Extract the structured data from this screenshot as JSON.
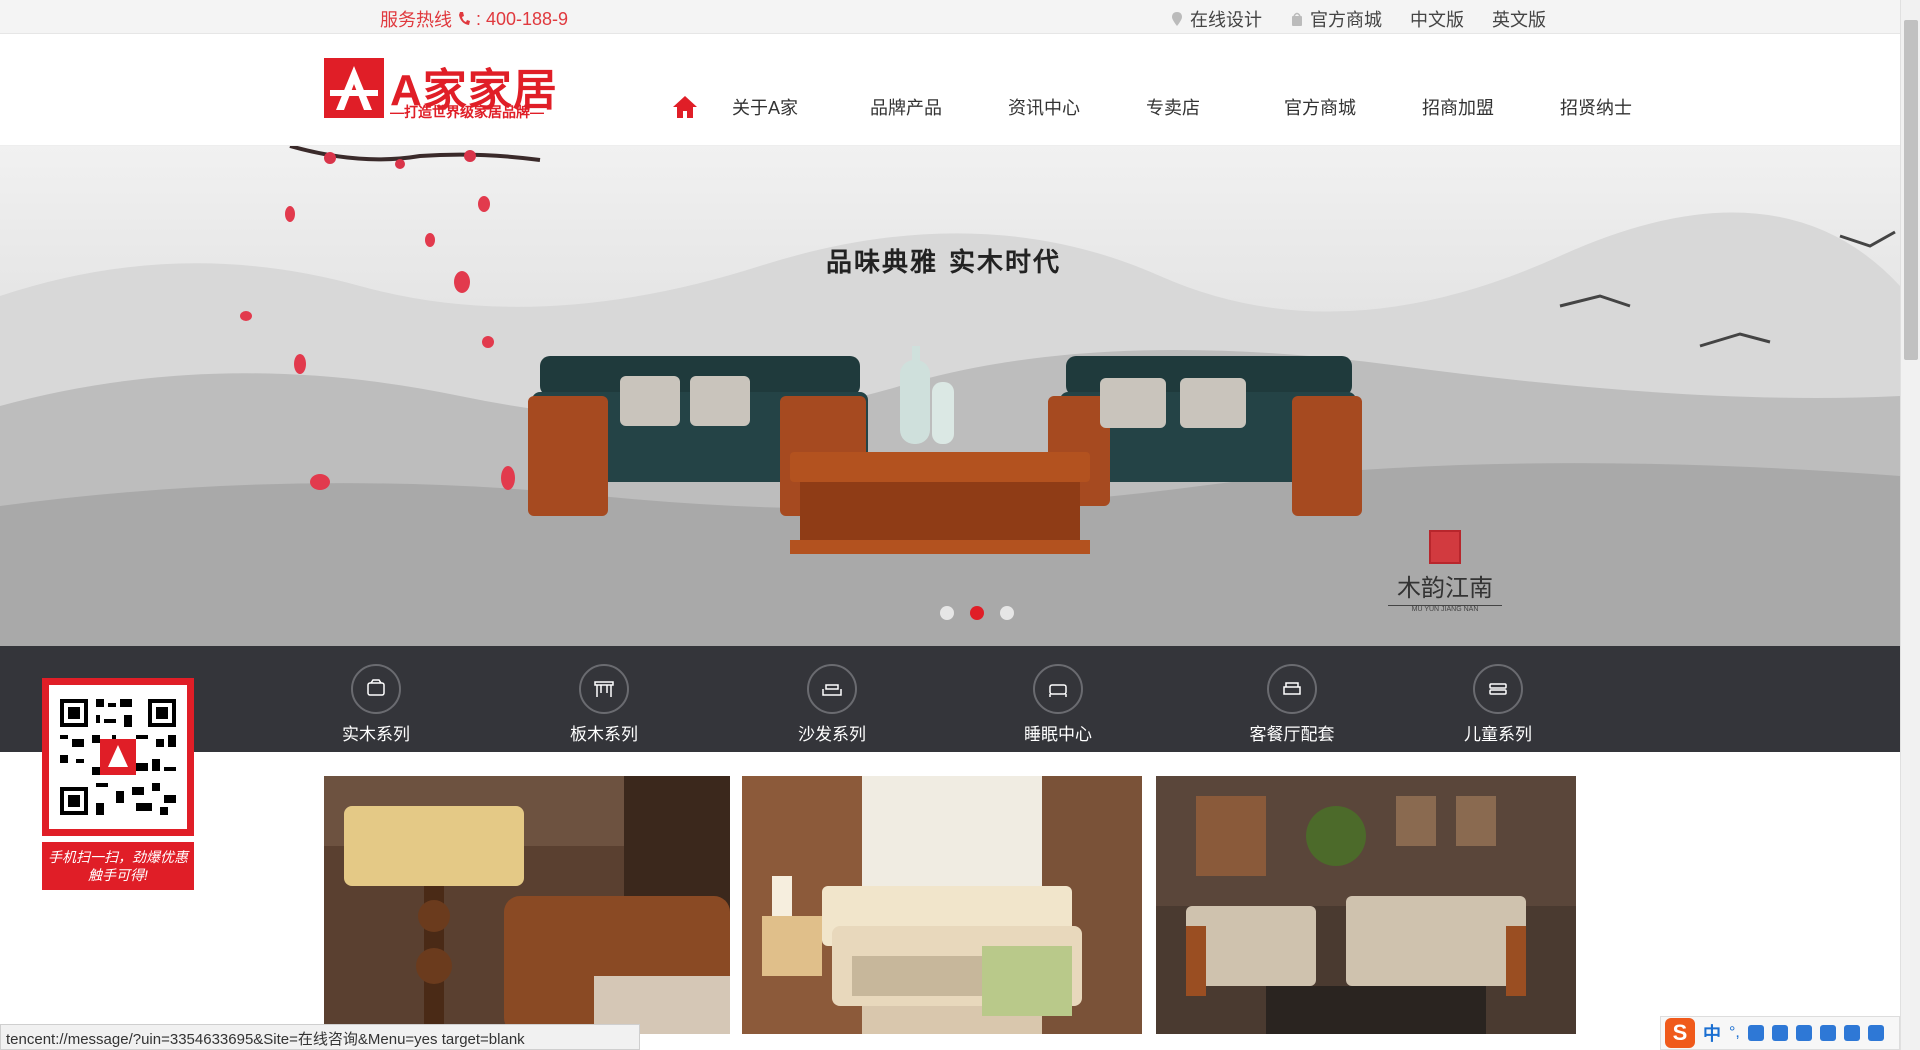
{
  "topbar": {
    "hotline_label": "服务热线",
    "hotline_number": ": 400-188-9",
    "links": [
      {
        "label": "在线设计",
        "icon": "location-pin-icon"
      },
      {
        "label": "官方商城",
        "icon": "shopping-bag-icon"
      },
      {
        "label": "中文版"
      },
      {
        "label": "英文版"
      }
    ]
  },
  "logo": {
    "title": "A家家居",
    "subtitle": "—打造世界级家居品牌—",
    "badge": "A"
  },
  "nav": {
    "items": [
      "关于A家",
      "品牌产品",
      "资讯中心",
      "专卖店",
      "官方商城",
      "招商加盟",
      "招贤纳士"
    ]
  },
  "banner": {
    "slogan": "品味典雅  实木时代",
    "brand_name": "木韵江南",
    "brand_sub": "MU YUN JIANG NAN",
    "dots": 3,
    "active_dot": 2
  },
  "categories": [
    {
      "label": "实木系列",
      "icon": "cabinet-icon"
    },
    {
      "label": "板木系列",
      "icon": "table-icon"
    },
    {
      "label": "沙发系列",
      "icon": "sofa-icon"
    },
    {
      "label": "睡眠中心",
      "icon": "bed-icon"
    },
    {
      "label": "客餐厅配套",
      "icon": "dining-sofa-icon"
    },
    {
      "label": "儿童系列",
      "icon": "kids-bed-icon"
    }
  ],
  "qr": {
    "caption": "手机扫一扫，劲爆优惠触手可得!"
  },
  "status_url": "tencent://message/?uin=3354633695&Site=在线咨询&Menu=yes target=blank",
  "ime": {
    "logo": "S",
    "lang": "中"
  },
  "colors": {
    "brand_red": "#e01e27",
    "cat_bar": "#34353a",
    "topbar_bg": "#f4f4f4"
  }
}
